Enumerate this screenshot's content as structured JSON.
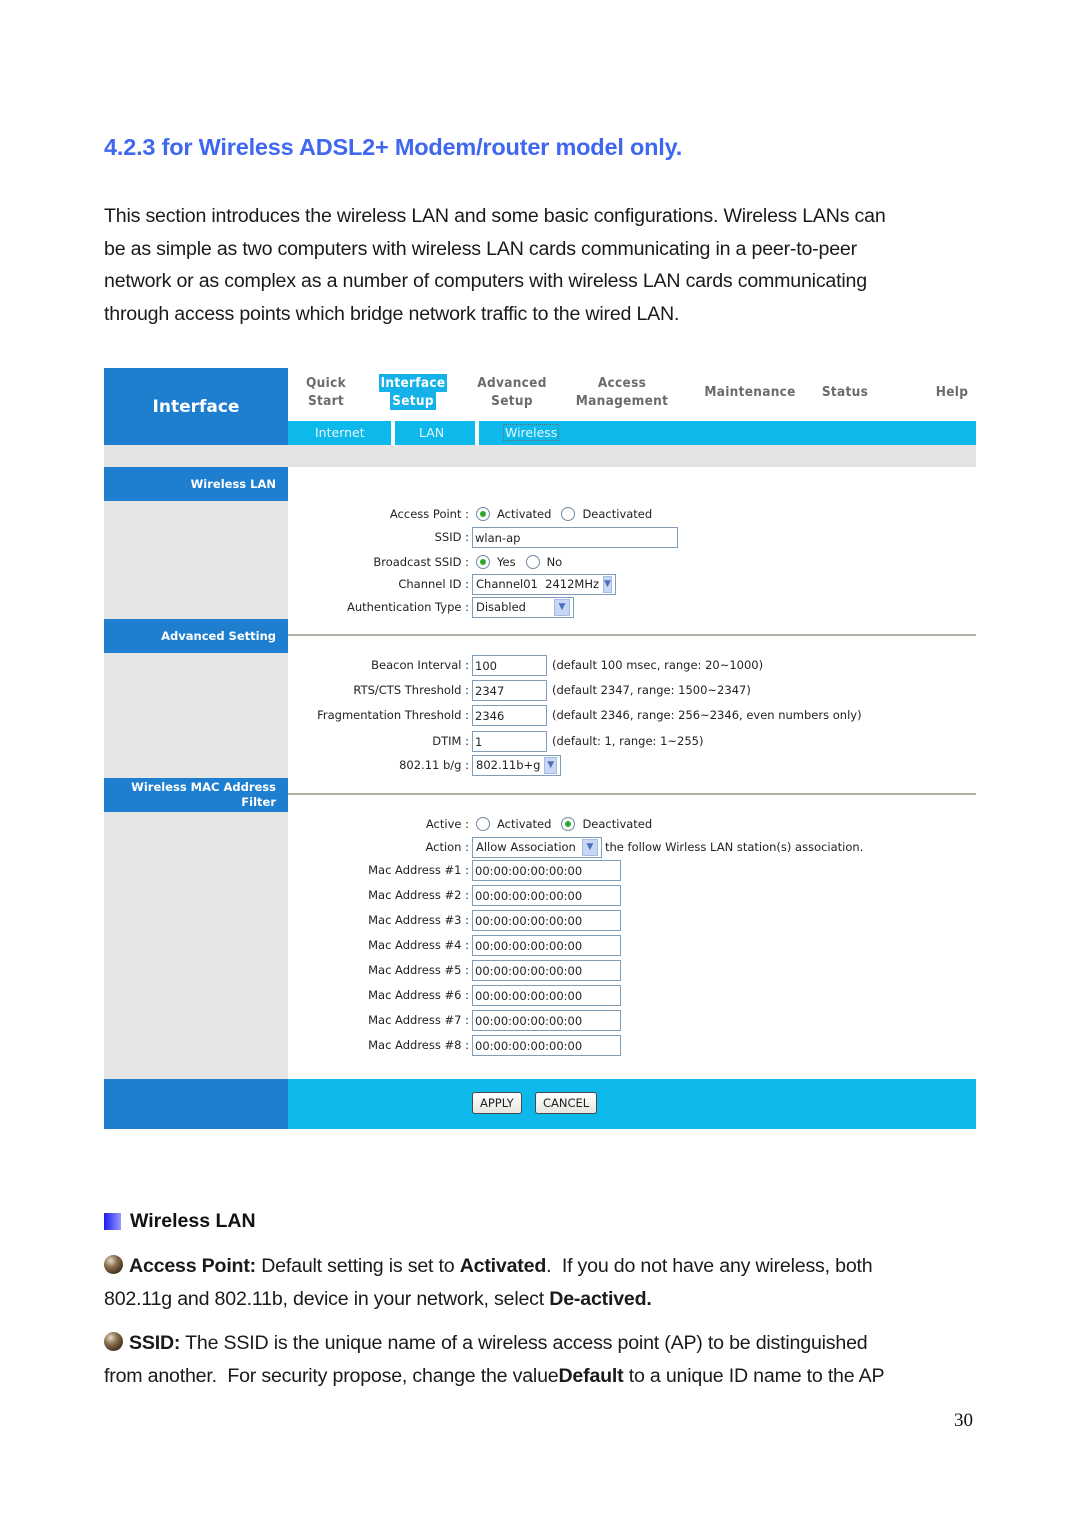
{
  "heading": "4.2.3 for Wireless ADSL2+ Modem/router model only.",
  "intro_lines": [
    "This section introduces the wireless LAN and some basic configurations. Wireless LANs can",
    "be as simple as two computers with wireless LAN cards communicating in a peer-to-peer",
    "network or as complex as a number of computers with wireless LAN cards communicating",
    "through access points which bridge network traffic to the wired LAN."
  ],
  "router_ui": {
    "brand": "Interface",
    "top_nav": [
      {
        "line1": "Quick",
        "line2": "Start"
      },
      {
        "line1": "Interface",
        "line2": "Setup",
        "active": true
      },
      {
        "line1": "Advanced",
        "line2": "Setup"
      },
      {
        "line1": "Access",
        "line2": "Management"
      },
      {
        "line1": "Maintenance"
      },
      {
        "line1": "Status"
      },
      {
        "line1": "Help"
      }
    ],
    "sub_nav": [
      "Internet",
      "LAN",
      "Wireless"
    ],
    "sub_nav_current": "Wireless",
    "sections": {
      "wireless_lan": "Wireless LAN",
      "advanced_setting": "Advanced Setting",
      "mac_filter_line1": "Wireless MAC Address",
      "mac_filter_line2": "Filter"
    },
    "wireless_lan": {
      "access_point_label": "Access Point :",
      "access_point_options": [
        "Activated",
        "Deactivated"
      ],
      "access_point_selected": "Activated",
      "ssid_label": "SSID :",
      "ssid_value": "wlan-ap",
      "broadcast_label": "Broadcast SSID :",
      "broadcast_options": [
        "Yes",
        "No"
      ],
      "broadcast_selected": "Yes",
      "channel_label": "Channel ID :",
      "channel_value": "Channel01  2412MHz",
      "auth_label": "Authentication Type :",
      "auth_value": "Disabled"
    },
    "advanced": {
      "beacon_label": "Beacon Interval :",
      "beacon_value": "100",
      "beacon_hint": "(default 100 msec, range: 20~1000)",
      "rts_label": "RTS/CTS Threshold :",
      "rts_value": "2347",
      "rts_hint": "(default 2347, range: 1500~2347)",
      "frag_label": "Fragmentation Threshold :",
      "frag_value": "2346",
      "frag_hint": "(default 2346, range: 256~2346, even numbers only)",
      "dtim_label": "DTIM :",
      "dtim_value": "1",
      "dtim_hint": "(default: 1, range: 1~255)",
      "mode_label": "802.11 b/g :",
      "mode_value": "802.11b+g"
    },
    "mac_filter": {
      "active_label": "Active :",
      "active_options": [
        "Activated",
        "Deactivated"
      ],
      "active_selected": "Deactivated",
      "action_label": "Action :",
      "action_value": "Allow Association",
      "action_hint": "the follow Wirless LAN station(s) association.",
      "addresses": [
        {
          "label": "Mac Address #1 :",
          "value": "00:00:00:00:00:00"
        },
        {
          "label": "Mac Address #2 :",
          "value": "00:00:00:00:00:00"
        },
        {
          "label": "Mac Address #3 :",
          "value": "00:00:00:00:00:00"
        },
        {
          "label": "Mac Address #4 :",
          "value": "00:00:00:00:00:00"
        },
        {
          "label": "Mac Address #5 :",
          "value": "00:00:00:00:00:00"
        },
        {
          "label": "Mac Address #6 :",
          "value": "00:00:00:00:00:00"
        },
        {
          "label": "Mac Address #7 :",
          "value": "00:00:00:00:00:00"
        },
        {
          "label": "Mac Address #8 :",
          "value": "00:00:00:00:00:00"
        }
      ]
    },
    "buttons": {
      "apply": "APPLY",
      "cancel": "CANCEL"
    },
    "colors": {
      "brand_blue": "#1e7fd0",
      "nav_cyan": "#0db8ea",
      "panel_gray": "#e6e6e6"
    }
  },
  "desc": {
    "section_title": "Wireless LAN",
    "access_point": {
      "term": "Access Point:",
      "text1": " Default setting is set to ",
      "bold1": "Activated",
      "text2": ".  If you do not have any wireless, both",
      "line2_text": "802.11g and 802.11b, device in your network, select ",
      "line2_bold": "De-actived."
    },
    "ssid": {
      "term": "SSID:",
      "text1": " The SSID is the unique name of a wireless access point (AP) to be distinguished",
      "line2_text1": "from another.  For security propose, change the value",
      "line2_bold": "Default",
      "line2_text2": " to a unique ID name to the AP"
    }
  },
  "page_number": "30"
}
